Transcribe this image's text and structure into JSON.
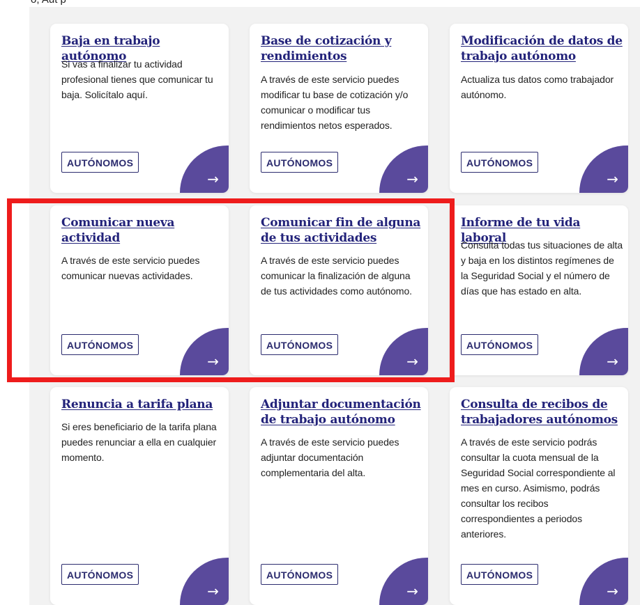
{
  "page": {
    "top_text": "o, Aut    p"
  },
  "cards": [
    {
      "title": "Baja en trabajo autónomo",
      "description": "Si vas a finalizar tu actividad profesional tienes que comunicar tu baja. Solicítalo aquí.",
      "tag": "AUTÓNOMOS",
      "arrow": "→"
    },
    {
      "title": "Base de cotización y rendimientos",
      "description": "A través de este servicio puedes modificar tu base de cotización y/o comunicar o modificar tus rendimientos netos esperados.",
      "tag": "AUTÓNOMOS",
      "arrow": "→"
    },
    {
      "title": "Modificación de datos de trabajo autónomo",
      "description": "Actualiza tus datos como trabajador autónomo.",
      "tag": "AUTÓNOMOS",
      "arrow": "→"
    },
    {
      "title": "Comunicar nueva actividad",
      "description": "A través de este servicio puedes comunicar nuevas actividades.",
      "tag": "AUTÓNOMOS",
      "arrow": "→"
    },
    {
      "title": "Comunicar fin de alguna de tus actividades",
      "description": "A través de este servicio puedes comunicar la finalización de alguna de tus actividades como autónomo.",
      "tag": "AUTÓNOMOS",
      "arrow": "→"
    },
    {
      "title": "Informe de tu vida laboral",
      "description": "Consulta todas tus situaciones de alta y baja en los distintos regímenes de la Seguridad Social y el número de días que has estado en alta.",
      "tag": "AUTÓNOMOS",
      "arrow": "→"
    },
    {
      "title": "Renuncia a tarifa plana",
      "description": "Si eres beneficiario de la tarifa plana puedes renunciar a ella en cualquier momento.",
      "tag": "AUTÓNOMOS",
      "arrow": "→"
    },
    {
      "title": "Adjuntar documentación de trabajo autónomo",
      "description": "A través de este servicio puedes adjuntar documentación complementaria del alta.",
      "tag": "AUTÓNOMOS",
      "arrow": "→"
    },
    {
      "title": "Consulta de recibos de trabajadores autónomos",
      "description": "A través de este servicio podrás consultar la cuota mensual de la Seguridad Social correspondiente al mes en curso. Asimismo, podrás consultar los recibos correspondientes a periodos anteriores.",
      "tag": "AUTÓNOMOS",
      "arrow": "→"
    }
  ],
  "colors": {
    "title": "#23237a",
    "arrow_button": "#5a4a9c",
    "highlight": "#ee1c1c",
    "panel_background": "#f2f2f2"
  }
}
